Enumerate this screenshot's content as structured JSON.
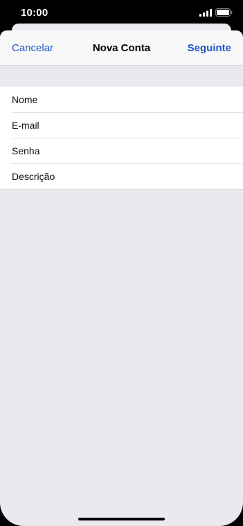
{
  "status_bar": {
    "time": "10:00",
    "icons": [
      "signal-icon",
      "battery-icon"
    ]
  },
  "nav": {
    "cancel_label": "Cancelar",
    "title": "Nova Conta",
    "next_label": "Seguinte"
  },
  "form": {
    "fields": [
      {
        "name": "name-field",
        "placeholder": "Nome",
        "value": ""
      },
      {
        "name": "email-field",
        "placeholder": "E-mail",
        "value": ""
      },
      {
        "name": "password-field",
        "placeholder": "Senha",
        "value": ""
      },
      {
        "name": "description-field",
        "placeholder": "Descrição",
        "value": ""
      }
    ]
  },
  "colors": {
    "accent": "#1f56c8",
    "background": "#e9e9ee",
    "nav_background": "#f8f8f8"
  }
}
